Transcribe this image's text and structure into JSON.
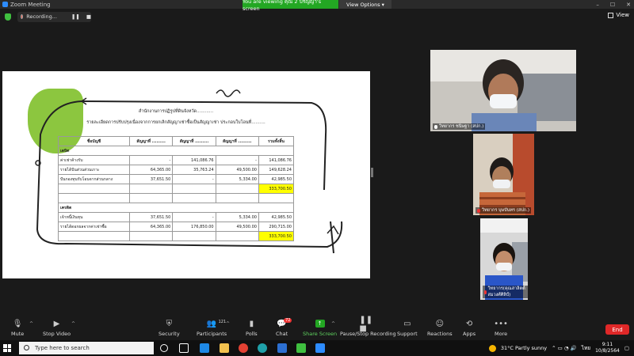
{
  "window": {
    "title": "Zoom Meeting",
    "controls": [
      "–",
      "☐",
      "✕"
    ]
  },
  "banner": {
    "viewing": "You are viewing คุณ 2 ปริญญา's screen",
    "view_options": "View Options ▾"
  },
  "toprow": {
    "recording_label": "Recording...",
    "pause": "❚❚",
    "stop": "■",
    "view_label": "View"
  },
  "share": {
    "title": "สำนักงานการปฏิรูปที่ดินจังหวัด............",
    "subtitle": "รายละเอียดการปรับปรุงเนื่องจากการยกเลิกสัญญาเช่าซื้อเป็นสัญญาเช่า ประกอบใบโอนที่..........",
    "columns": [
      "ชื่อบัญชี",
      "สัญญาที่ .........",
      "สัญญาที่ .........",
      "สัญญาที่ .........",
      "รวมทั้งสิ้น"
    ],
    "rows": [
      {
        "section": "เดบิต"
      },
      {
        "label": "ค่าเช่าค้างรับ",
        "c1": "-",
        "c2": "141,086.76",
        "c3": "-",
        "total": "141,086.76"
      },
      {
        "label": "รายได้ปันส่วนส่วนเกาะ",
        "c1": "64,365.00",
        "c2": "35,763.24",
        "c3": "49,500.00",
        "total": "149,628.24"
      },
      {
        "label": "ปันกองทุนรับโอนจากส่วนกลาง",
        "c1": "37,651.50",
        "c2": "-",
        "c3": "5,334.00",
        "total": "42,985.50"
      },
      {
        "label": "",
        "c1": "",
        "c2": "",
        "c3": "",
        "total": "333,700.50",
        "highlight": true
      },
      {
        "label": "",
        "c1": "",
        "c2": "",
        "c3": "",
        "total": ""
      },
      {
        "section": "เครดิต"
      },
      {
        "label": "เจ้าหนี้เงินทุน",
        "c1": "37,651.50",
        "c2": "-",
        "c3": "5,334.00",
        "total": "42,985.50"
      },
      {
        "label": "รายได้ดอกผลจากค่าเช่าซื้อ",
        "c1": "64,365.00",
        "c2": "176,850.00",
        "c3": "49,500.00",
        "total": "290,715.00"
      },
      {
        "label": "",
        "c1": "",
        "c2": "",
        "c3": "",
        "total": "333,700.50",
        "highlight": true
      }
    ]
  },
  "participants": [
    {
      "name": "วิทยากร ชนิษฐา (สปก.)",
      "muted": false
    },
    {
      "name": "วิทยากร บุษบันทร (สปก.)",
      "muted": true
    },
    {
      "name": "วิทยากร(คุณสาลิตต์ สมวงศ์ศิลิป์)",
      "muted": true
    }
  ],
  "toolbar": {
    "mute": "Mute",
    "stop_video": "Stop Video",
    "security": "Security",
    "participants": "Participants",
    "participants_count": "121",
    "polls": "Polls",
    "chat": "Chat",
    "chat_badge": "72",
    "share_screen": "Share Screen",
    "pause_recording": "Pause/Stop Recording",
    "support": "Support",
    "reactions": "Reactions",
    "apps": "Apps",
    "more": "More",
    "end": "End"
  },
  "taskbar": {
    "search_placeholder": "Type here to search",
    "weather": "31°C  Partly sunny",
    "lang": "ไทย",
    "time": "9:11",
    "date": "10/8/2564"
  },
  "colors": {
    "share_green": "#23a723",
    "end_red": "#e02828",
    "highlight_yellow": "#ffff00",
    "blob_green": "#8cc63f"
  }
}
